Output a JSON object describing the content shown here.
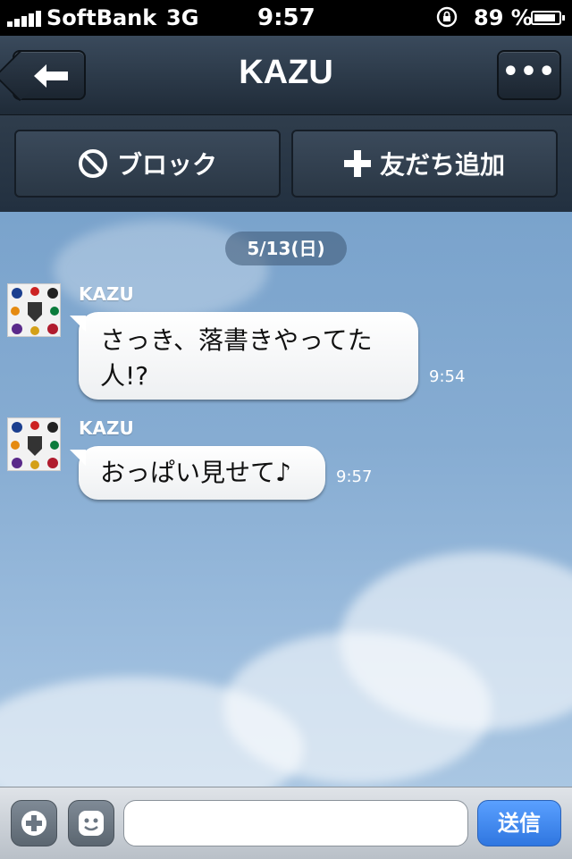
{
  "status_bar": {
    "carrier": "SoftBank",
    "network": "3G",
    "time": "9:57",
    "battery_percent": "89 %",
    "battery_level": 0.89
  },
  "navbar": {
    "back_icon": "back-arrow-icon",
    "title": "KAZU",
    "more_label": "•••"
  },
  "actions": {
    "block_label": "ブロック",
    "block_icon": "block-icon",
    "add_friend_label": "友だち追加",
    "add_friend_icon": "plus-icon"
  },
  "chat": {
    "date": "5/13(日)",
    "messages": [
      {
        "sender": "KAZU",
        "text_line1": "さっき、落書きやってた",
        "text_line2": "人!?",
        "time": "9:54"
      },
      {
        "sender": "KAZU",
        "text_line1": "おっぱい見せて♪",
        "time": "9:57"
      }
    ]
  },
  "input": {
    "placeholder": "",
    "send_label": "送信"
  },
  "colors": {
    "nav_bg": "#2a3746",
    "chat_bg": "#86acd2",
    "send_button": "#3a82ee"
  }
}
